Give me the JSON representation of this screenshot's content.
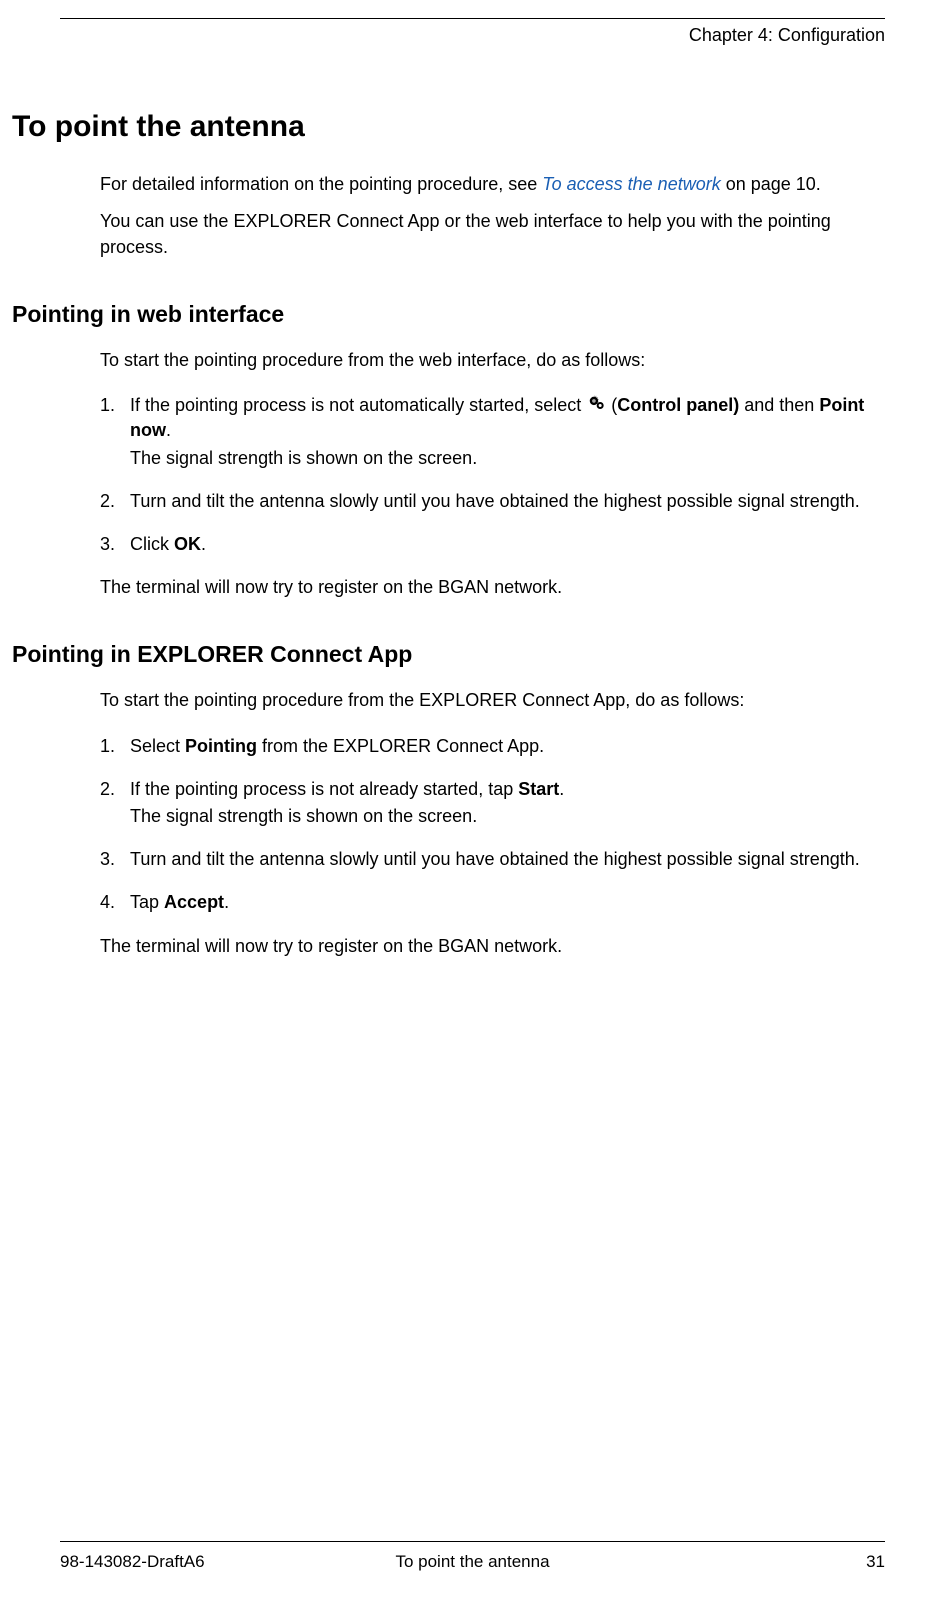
{
  "header": {
    "chapter": "Chapter 4: Configuration"
  },
  "title": "To point the antenna",
  "intro": {
    "p1_before": "For detailed information on the pointing procedure, see ",
    "p1_link": "To access the network",
    "p1_after": " on page 10.",
    "p2": "You can use the EXPLORER Connect App or the web interface to help you with the pointing process."
  },
  "section1": {
    "heading": "Pointing in web interface",
    "intro": "To start the pointing procedure from the web interface, do as follows:",
    "steps": {
      "n1": "1.",
      "s1a": "If the pointing process is not automatically started, select ",
      "s1b_open": " (",
      "s1b_bold": "Control panel)",
      "s1c": " and then ",
      "s1d_bold": "Point now",
      "s1e": ".",
      "s1_sub": "The signal strength is shown on the screen.",
      "n2": "2.",
      "s2": "Turn and tilt the antenna slowly until you have obtained the highest possible signal strength.",
      "n3": "3.",
      "s3a": "Click ",
      "s3b_bold": "OK",
      "s3c": "."
    },
    "after": "The terminal will now try to register on the BGAN network."
  },
  "section2": {
    "heading": "Pointing in EXPLORER Connect App",
    "intro": "To start the pointing procedure from the EXPLORER Connect App, do as follows:",
    "steps": {
      "n1": "1.",
      "s1a": "Select ",
      "s1b_bold": "Pointing",
      "s1c": " from the EXPLORER Connect App.",
      "n2": "2.",
      "s2a": "If the pointing process is not already started, tap ",
      "s2b_bold": "Start",
      "s2c": ".",
      "s2_sub": "The signal strength is shown on the screen.",
      "n3": "3.",
      "s3": "Turn and tilt the antenna slowly until you have obtained the highest possible signal strength.",
      "n4": "4.",
      "s4a": "Tap ",
      "s4b_bold": "Accept",
      "s4c": "."
    },
    "after": "The terminal will now try to register on the BGAN network."
  },
  "footer": {
    "left": "98-143082-DraftA6",
    "center": "To point the antenna",
    "right": "31"
  }
}
